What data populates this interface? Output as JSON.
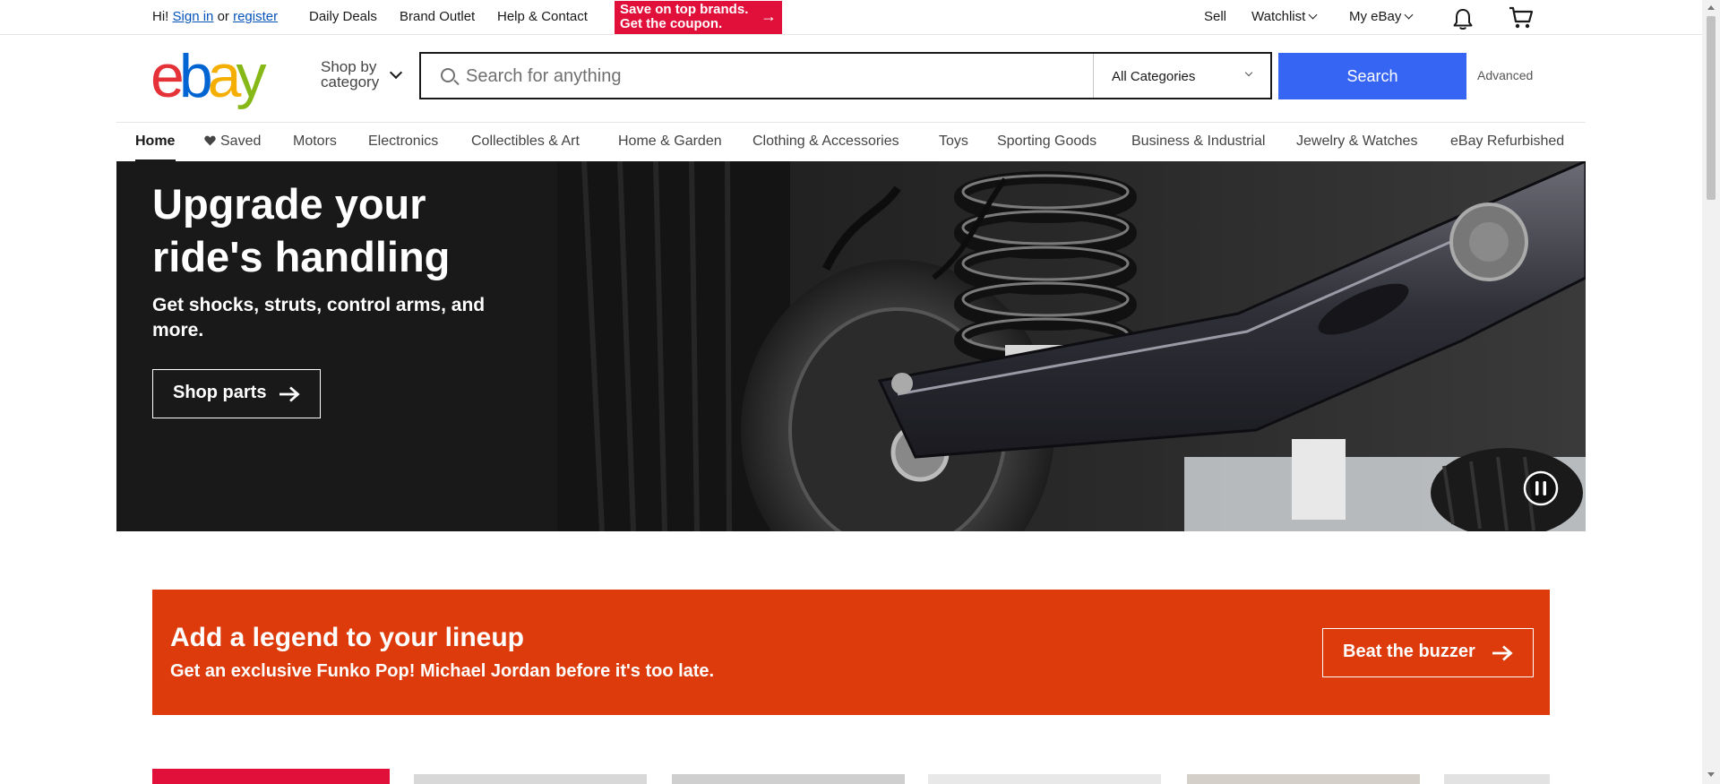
{
  "topbar": {
    "greeting": "Hi!",
    "sign_in": "Sign in",
    "or": "or",
    "register": "register",
    "daily_deals": "Daily Deals",
    "brand_outlet": "Brand Outlet",
    "help": "Help & Contact",
    "promo_line1": "Save on top brands.",
    "promo_line2": "Get the coupon.",
    "sell": "Sell",
    "watchlist": "Watchlist",
    "my_ebay": "My eBay"
  },
  "header": {
    "logo": [
      "e",
      "b",
      "a",
      "y"
    ],
    "logo_colors": [
      "#e53238",
      "#0064d2",
      "#f5af02",
      "#86b817"
    ],
    "shop_by_1": "Shop by",
    "shop_by_2": "category",
    "search_placeholder": "Search for anything",
    "category": "All Categories",
    "search_button": "Search",
    "advanced": "Advanced"
  },
  "nav": {
    "items": [
      "Home",
      "Saved",
      "Motors",
      "Electronics",
      "Collectibles & Art",
      "Home & Garden",
      "Clothing & Accessories",
      "Toys",
      "Sporting Goods",
      "Business & Industrial",
      "Jewelry & Watches",
      "eBay Refurbished"
    ]
  },
  "hero": {
    "title": "Upgrade your ride's handling",
    "subtitle": "Get shocks, struts, control arms, and more.",
    "cta": "Shop parts"
  },
  "banner": {
    "title": "Add a legend to your lineup",
    "subtitle": "Get an exclusive Funko Pop! Michael Jordan before it's too late.",
    "cta": "Beat the buzzer",
    "color": "#dd3b0c"
  },
  "colors": {
    "search_button": "#3665f3",
    "link": "#0654ba",
    "promo": "#e0103a"
  }
}
